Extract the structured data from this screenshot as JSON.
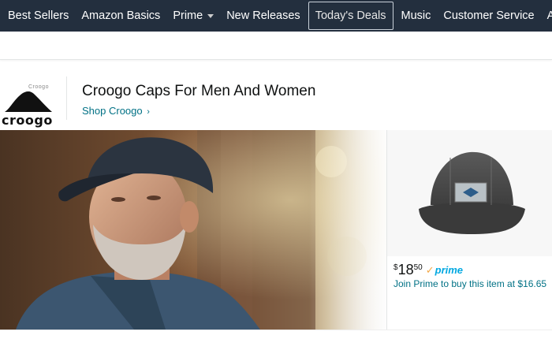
{
  "nav": {
    "items": [
      {
        "label": "Best Sellers"
      },
      {
        "label": "Amazon Basics"
      },
      {
        "label": "Prime"
      },
      {
        "label": "New Releases"
      },
      {
        "label": "Today's Deals"
      },
      {
        "label": "Music"
      },
      {
        "label": "Customer Service"
      },
      {
        "label": "Amazon"
      }
    ],
    "active": "Today's Deals"
  },
  "brand": {
    "logo_small_text": "Croogo",
    "logo_word": "croogo",
    "title": "Croogo Caps For Men And Women",
    "shop_link": "Shop Croogo"
  },
  "product": {
    "price_symbol": "$",
    "price_whole": "18",
    "price_fraction": "50",
    "prime_label": "prime",
    "join_text": "Join Prime to buy this item at $16.65"
  },
  "colors": {
    "nav_bg": "#232f3e",
    "link": "#007185",
    "prime_blue": "#00a8e1",
    "prime_check": "#f3a847"
  },
  "icons": [
    "mountain-logo-icon",
    "chevron-right-icon",
    "caret-down-icon",
    "prime-check-icon"
  ]
}
